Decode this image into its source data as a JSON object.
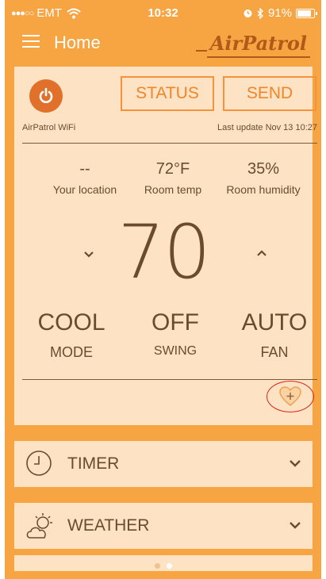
{
  "status_bar": {
    "carrier": "EMT",
    "time": "10:32",
    "battery": "91%",
    "signal_dots": "●●●○○"
  },
  "nav": {
    "title": "Home",
    "logo_text": "AirPatrol"
  },
  "controls": {
    "status_label": "STATUS",
    "send_label": "SEND"
  },
  "device": {
    "name": "AirPatrol WiFi",
    "last_update": "Last update Nov 13 10:27"
  },
  "readings": [
    {
      "value": "--",
      "label": "Your location"
    },
    {
      "value": "72°F",
      "label": "Room temp"
    },
    {
      "value": "35%",
      "label": "Room humidity"
    }
  ],
  "setpoint": "70",
  "settings": [
    {
      "value": "COOL",
      "label": "MODE"
    },
    {
      "value": "OFF",
      "label": "SWING"
    },
    {
      "value": "AUTO",
      "label": "FAN"
    }
  ],
  "sections": [
    {
      "label": "TIMER",
      "icon": "clock-icon"
    },
    {
      "label": "WEATHER",
      "icon": "weather-icon"
    }
  ],
  "pager": {
    "pages": 2,
    "active": 2
  },
  "colors": {
    "background": "#f7a442",
    "card": "#fde3c4",
    "accent": "#f0852a",
    "text": "#6b4a2e",
    "highlight_ring": "#d9261c"
  }
}
